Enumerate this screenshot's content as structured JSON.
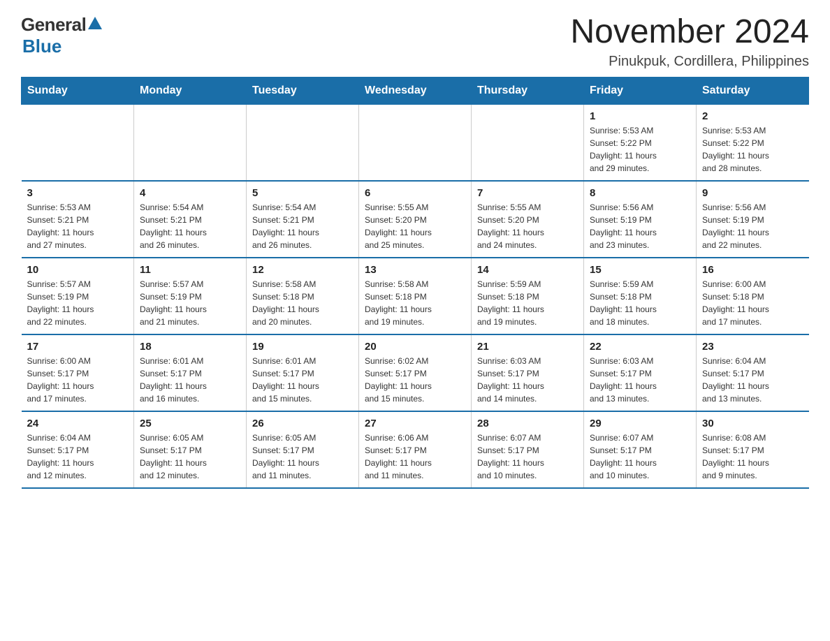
{
  "header": {
    "logo_general": "General",
    "logo_blue": "Blue",
    "month_title": "November 2024",
    "location": "Pinukpuk, Cordillera, Philippines"
  },
  "days_of_week": [
    "Sunday",
    "Monday",
    "Tuesday",
    "Wednesday",
    "Thursday",
    "Friday",
    "Saturday"
  ],
  "weeks": [
    {
      "days": [
        {
          "number": "",
          "info": ""
        },
        {
          "number": "",
          "info": ""
        },
        {
          "number": "",
          "info": ""
        },
        {
          "number": "",
          "info": ""
        },
        {
          "number": "",
          "info": ""
        },
        {
          "number": "1",
          "info": "Sunrise: 5:53 AM\nSunset: 5:22 PM\nDaylight: 11 hours\nand 29 minutes."
        },
        {
          "number": "2",
          "info": "Sunrise: 5:53 AM\nSunset: 5:22 PM\nDaylight: 11 hours\nand 28 minutes."
        }
      ]
    },
    {
      "days": [
        {
          "number": "3",
          "info": "Sunrise: 5:53 AM\nSunset: 5:21 PM\nDaylight: 11 hours\nand 27 minutes."
        },
        {
          "number": "4",
          "info": "Sunrise: 5:54 AM\nSunset: 5:21 PM\nDaylight: 11 hours\nand 26 minutes."
        },
        {
          "number": "5",
          "info": "Sunrise: 5:54 AM\nSunset: 5:21 PM\nDaylight: 11 hours\nand 26 minutes."
        },
        {
          "number": "6",
          "info": "Sunrise: 5:55 AM\nSunset: 5:20 PM\nDaylight: 11 hours\nand 25 minutes."
        },
        {
          "number": "7",
          "info": "Sunrise: 5:55 AM\nSunset: 5:20 PM\nDaylight: 11 hours\nand 24 minutes."
        },
        {
          "number": "8",
          "info": "Sunrise: 5:56 AM\nSunset: 5:19 PM\nDaylight: 11 hours\nand 23 minutes."
        },
        {
          "number": "9",
          "info": "Sunrise: 5:56 AM\nSunset: 5:19 PM\nDaylight: 11 hours\nand 22 minutes."
        }
      ]
    },
    {
      "days": [
        {
          "number": "10",
          "info": "Sunrise: 5:57 AM\nSunset: 5:19 PM\nDaylight: 11 hours\nand 22 minutes."
        },
        {
          "number": "11",
          "info": "Sunrise: 5:57 AM\nSunset: 5:19 PM\nDaylight: 11 hours\nand 21 minutes."
        },
        {
          "number": "12",
          "info": "Sunrise: 5:58 AM\nSunset: 5:18 PM\nDaylight: 11 hours\nand 20 minutes."
        },
        {
          "number": "13",
          "info": "Sunrise: 5:58 AM\nSunset: 5:18 PM\nDaylight: 11 hours\nand 19 minutes."
        },
        {
          "number": "14",
          "info": "Sunrise: 5:59 AM\nSunset: 5:18 PM\nDaylight: 11 hours\nand 19 minutes."
        },
        {
          "number": "15",
          "info": "Sunrise: 5:59 AM\nSunset: 5:18 PM\nDaylight: 11 hours\nand 18 minutes."
        },
        {
          "number": "16",
          "info": "Sunrise: 6:00 AM\nSunset: 5:18 PM\nDaylight: 11 hours\nand 17 minutes."
        }
      ]
    },
    {
      "days": [
        {
          "number": "17",
          "info": "Sunrise: 6:00 AM\nSunset: 5:17 PM\nDaylight: 11 hours\nand 17 minutes."
        },
        {
          "number": "18",
          "info": "Sunrise: 6:01 AM\nSunset: 5:17 PM\nDaylight: 11 hours\nand 16 minutes."
        },
        {
          "number": "19",
          "info": "Sunrise: 6:01 AM\nSunset: 5:17 PM\nDaylight: 11 hours\nand 15 minutes."
        },
        {
          "number": "20",
          "info": "Sunrise: 6:02 AM\nSunset: 5:17 PM\nDaylight: 11 hours\nand 15 minutes."
        },
        {
          "number": "21",
          "info": "Sunrise: 6:03 AM\nSunset: 5:17 PM\nDaylight: 11 hours\nand 14 minutes."
        },
        {
          "number": "22",
          "info": "Sunrise: 6:03 AM\nSunset: 5:17 PM\nDaylight: 11 hours\nand 13 minutes."
        },
        {
          "number": "23",
          "info": "Sunrise: 6:04 AM\nSunset: 5:17 PM\nDaylight: 11 hours\nand 13 minutes."
        }
      ]
    },
    {
      "days": [
        {
          "number": "24",
          "info": "Sunrise: 6:04 AM\nSunset: 5:17 PM\nDaylight: 11 hours\nand 12 minutes."
        },
        {
          "number": "25",
          "info": "Sunrise: 6:05 AM\nSunset: 5:17 PM\nDaylight: 11 hours\nand 12 minutes."
        },
        {
          "number": "26",
          "info": "Sunrise: 6:05 AM\nSunset: 5:17 PM\nDaylight: 11 hours\nand 11 minutes."
        },
        {
          "number": "27",
          "info": "Sunrise: 6:06 AM\nSunset: 5:17 PM\nDaylight: 11 hours\nand 11 minutes."
        },
        {
          "number": "28",
          "info": "Sunrise: 6:07 AM\nSunset: 5:17 PM\nDaylight: 11 hours\nand 10 minutes."
        },
        {
          "number": "29",
          "info": "Sunrise: 6:07 AM\nSunset: 5:17 PM\nDaylight: 11 hours\nand 10 minutes."
        },
        {
          "number": "30",
          "info": "Sunrise: 6:08 AM\nSunset: 5:17 PM\nDaylight: 11 hours\nand 9 minutes."
        }
      ]
    }
  ]
}
